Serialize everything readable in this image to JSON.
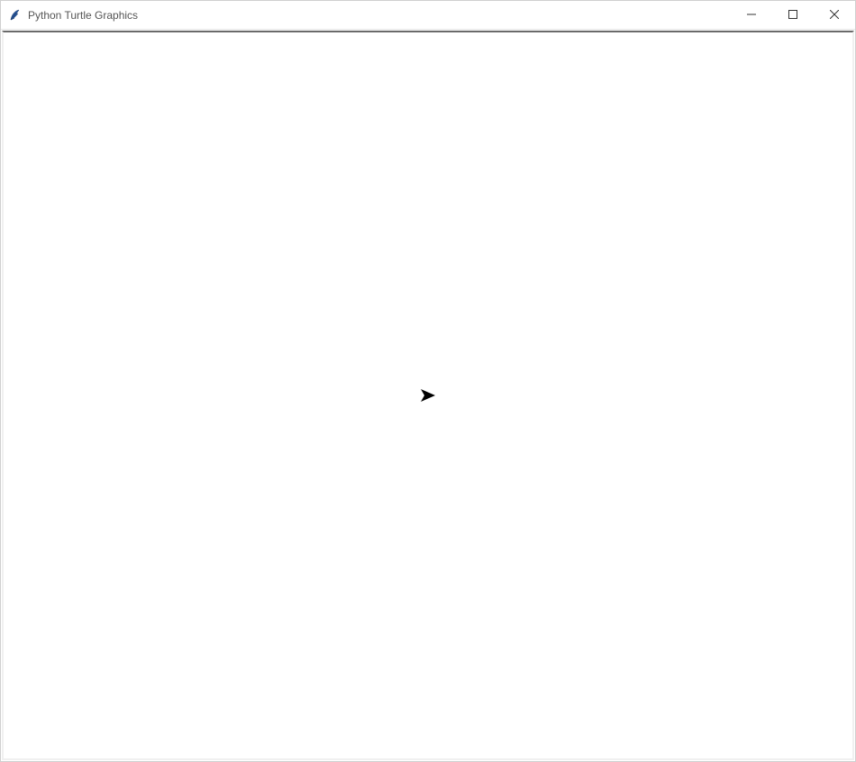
{
  "window": {
    "title": "Python Turtle Graphics",
    "icon": "feather-icon"
  },
  "controls": {
    "minimize": "minimize-icon",
    "maximize": "maximize-icon",
    "close": "close-icon"
  },
  "canvas": {
    "turtle": {
      "heading_deg": 0,
      "shape": "classic-arrow"
    }
  }
}
